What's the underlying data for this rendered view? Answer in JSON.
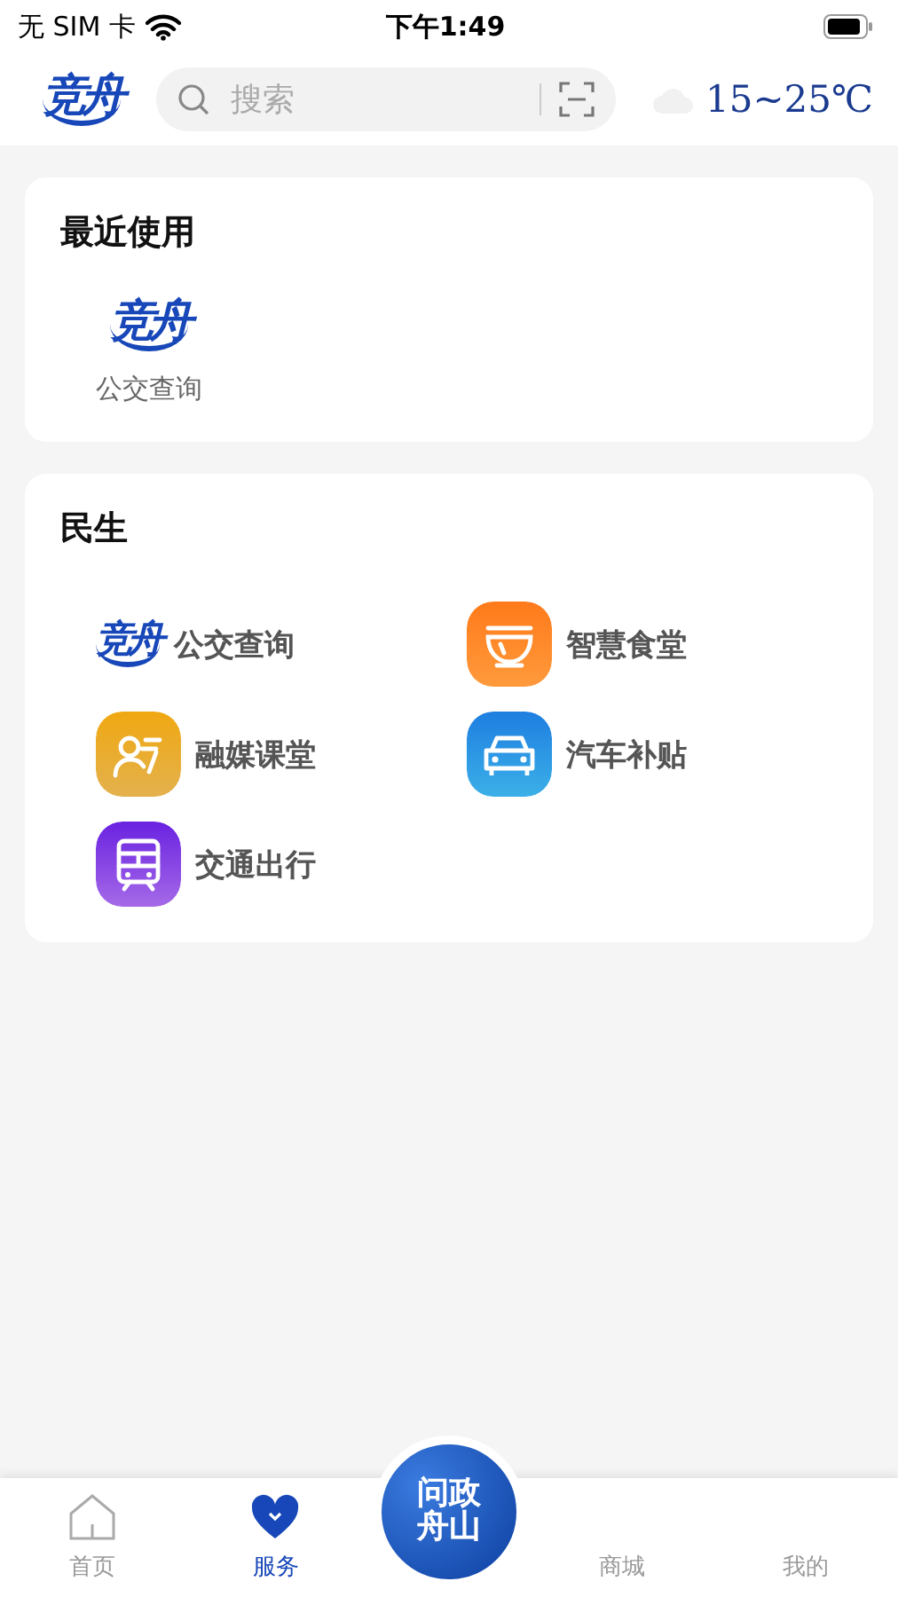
{
  "status_bar": {
    "carrier": "无 SIM 卡",
    "time": "下午1:49"
  },
  "header": {
    "logo": "竞舟",
    "search": {
      "placeholder": "搜索"
    },
    "weather": "15~25℃"
  },
  "recent": {
    "title": "最近使用",
    "items": [
      {
        "kind": "logo",
        "logo": "竞舟",
        "label": "公交查询"
      }
    ]
  },
  "section": {
    "title": "民生",
    "items": [
      {
        "kind": "logo",
        "logo": "竞舟",
        "label": "公交查询"
      },
      {
        "kind": "bowl",
        "label": "智慧食堂"
      },
      {
        "kind": "person",
        "label": "融媒课堂"
      },
      {
        "kind": "car",
        "label": "汽车补贴"
      },
      {
        "kind": "train",
        "label": "交通出行"
      }
    ]
  },
  "tab_bar": {
    "tabs": [
      {
        "kind": "home",
        "label": "首页",
        "selected": false
      },
      {
        "kind": "heart",
        "label": "服务",
        "selected": true
      },
      {
        "kind": "center",
        "label": "问政舟山"
      },
      {
        "kind": "plain",
        "label": "商城",
        "selected": false
      },
      {
        "kind": "plain",
        "label": "我的",
        "selected": false
      }
    ]
  }
}
